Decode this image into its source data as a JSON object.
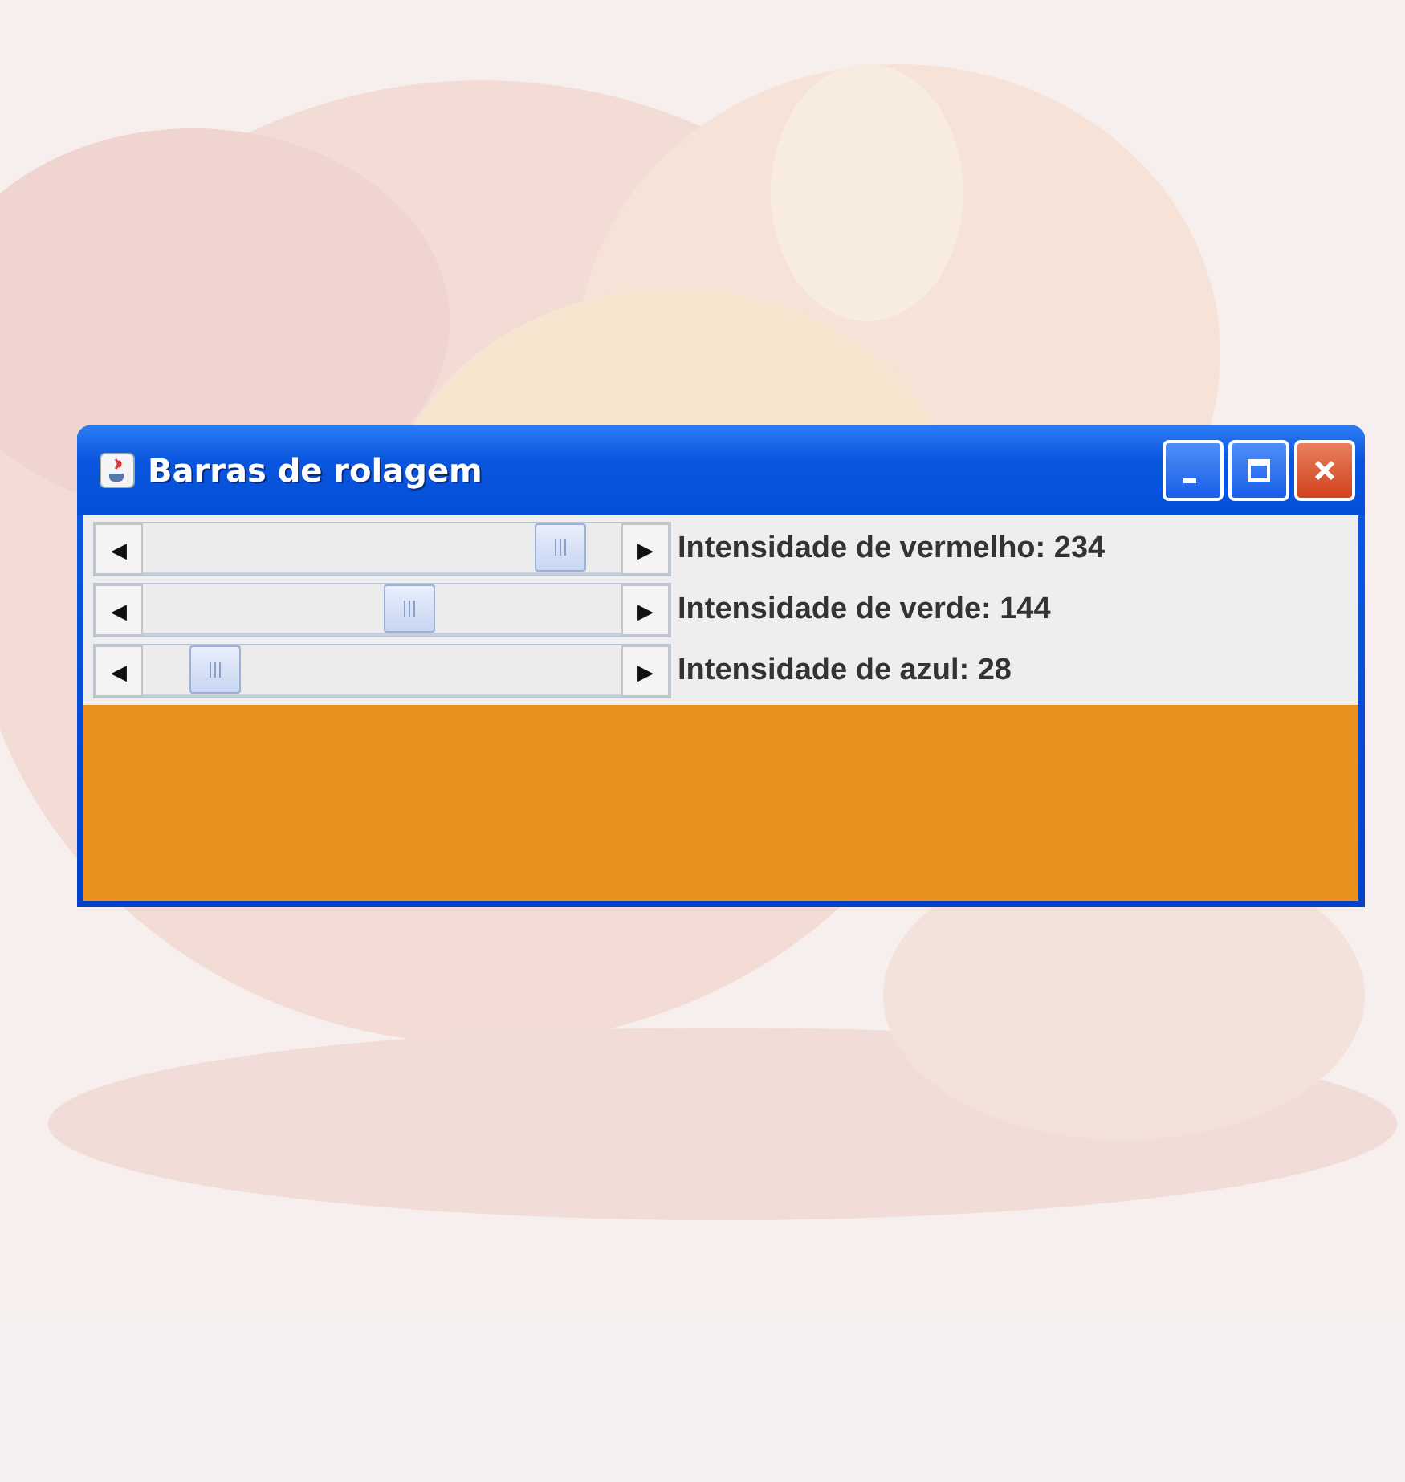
{
  "window": {
    "title": "Barras de rolagem"
  },
  "sliders": [
    {
      "level": 0.918,
      "label": "Intensidade de vermelho: 234"
    },
    {
      "level": 0.565,
      "label": "Intensidade de verde: 144"
    },
    {
      "level": 0.11,
      "label": "Intensidade de azul: 28"
    }
  ],
  "preview": {
    "color": "#ea901c"
  },
  "arrows": {
    "left": "◀",
    "right": "▶"
  }
}
